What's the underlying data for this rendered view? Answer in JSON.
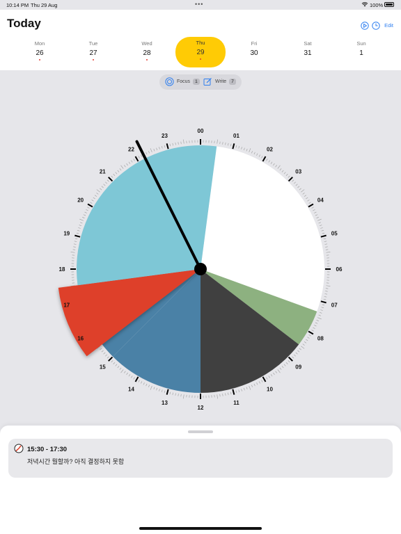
{
  "status_bar": {
    "time": "10:14 PM",
    "date": "Thu 29 Aug",
    "battery": "100%"
  },
  "header": {
    "title": "Today",
    "edit_label": "Edit"
  },
  "week": [
    {
      "name": "Mon",
      "num": "26",
      "has_event": true
    },
    {
      "name": "Tue",
      "num": "27",
      "has_event": true
    },
    {
      "name": "Wed",
      "num": "28",
      "has_event": true
    },
    {
      "name": "Thu",
      "num": "29",
      "has_event": true,
      "selected": true
    },
    {
      "name": "Fri",
      "num": "30",
      "has_event": false
    },
    {
      "name": "Sat",
      "num": "31",
      "has_event": false
    },
    {
      "name": "Sun",
      "num": "1",
      "has_event": false
    }
  ],
  "filters": [
    {
      "label": "Focus",
      "count": "1",
      "icon": "focus-target-icon"
    },
    {
      "label": "Write",
      "count": "7",
      "icon": "compose-icon"
    }
  ],
  "clock": {
    "hour_labels": [
      "00",
      "01",
      "02",
      "03",
      "04",
      "05",
      "06",
      "07",
      "08",
      "09",
      "10",
      "11",
      "12",
      "13",
      "14",
      "15",
      "16",
      "17",
      "18",
      "19",
      "20",
      "21",
      "22",
      "23"
    ],
    "current_time": "22:14",
    "segments": [
      {
        "start": "00:30",
        "end": "07:20",
        "color": "#ffffff"
      },
      {
        "start": "07:20",
        "end": "08:30",
        "color": "#8db180"
      },
      {
        "start": "08:30",
        "end": "12:00",
        "color": "#404040"
      },
      {
        "start": "12:00",
        "end": "15:00",
        "color": "#4a81a6"
      },
      {
        "start": "15:00",
        "end": "17:30",
        "color": "#4a81a6"
      },
      {
        "start": "15:30",
        "end": "17:30",
        "color": "#de3f2a",
        "selected": true
      },
      {
        "start": "17:30",
        "end": "00:30",
        "color": "#7ec7d6"
      }
    ]
  },
  "event": {
    "time": "15:30 - 17:30",
    "description": "저녁시간 뭘할까? 아직 결정하지 못함"
  }
}
